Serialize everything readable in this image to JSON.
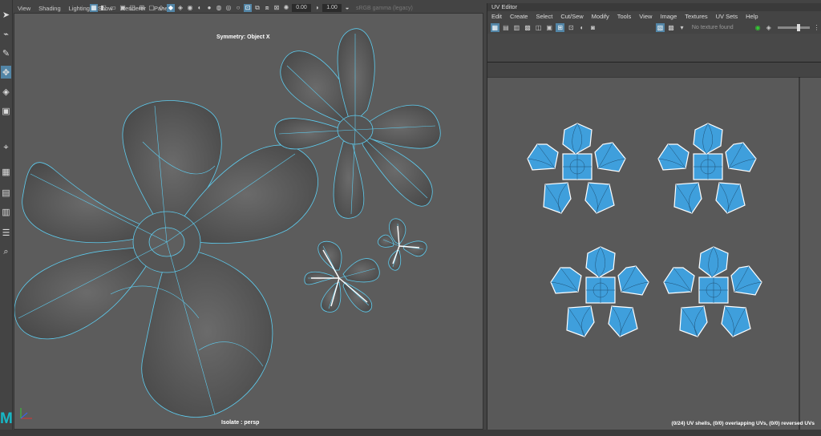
{
  "viewport": {
    "menus": [
      "View",
      "Shading",
      "Lighting",
      "Show",
      "Renderer",
      "Panels"
    ],
    "field_a": "0.00",
    "field_b": "1.00",
    "color_space": "sRGB gamma (legacy)",
    "hud_symmetry": "Symmetry: Object X",
    "hud_isolate": "Isolate : persp"
  },
  "uv_editor": {
    "title": "UV Editor",
    "menus": [
      "Edit",
      "Create",
      "Select",
      "Cut/Sew",
      "Modify",
      "Tools",
      "View",
      "Image",
      "Textures",
      "UV Sets",
      "Help"
    ],
    "texture_label": "No texture found",
    "status": "(0/24) UV shells, (0/0) overlapping UVs, (0/0) reversed UVs"
  },
  "colors": {
    "wireframe": "#5ecdf0",
    "uv_fill": "#3f9fdc",
    "accent": "#5285a6",
    "logo": "#17b8c6"
  },
  "toolbox": {
    "icons": [
      "select-arrow-icon",
      "lasso-icon",
      "paint-select-icon",
      "move-icon",
      "rotate-icon",
      "scale-icon",
      "snap-icon",
      "outliner-icon",
      "layout-icon",
      "search-icon"
    ]
  }
}
